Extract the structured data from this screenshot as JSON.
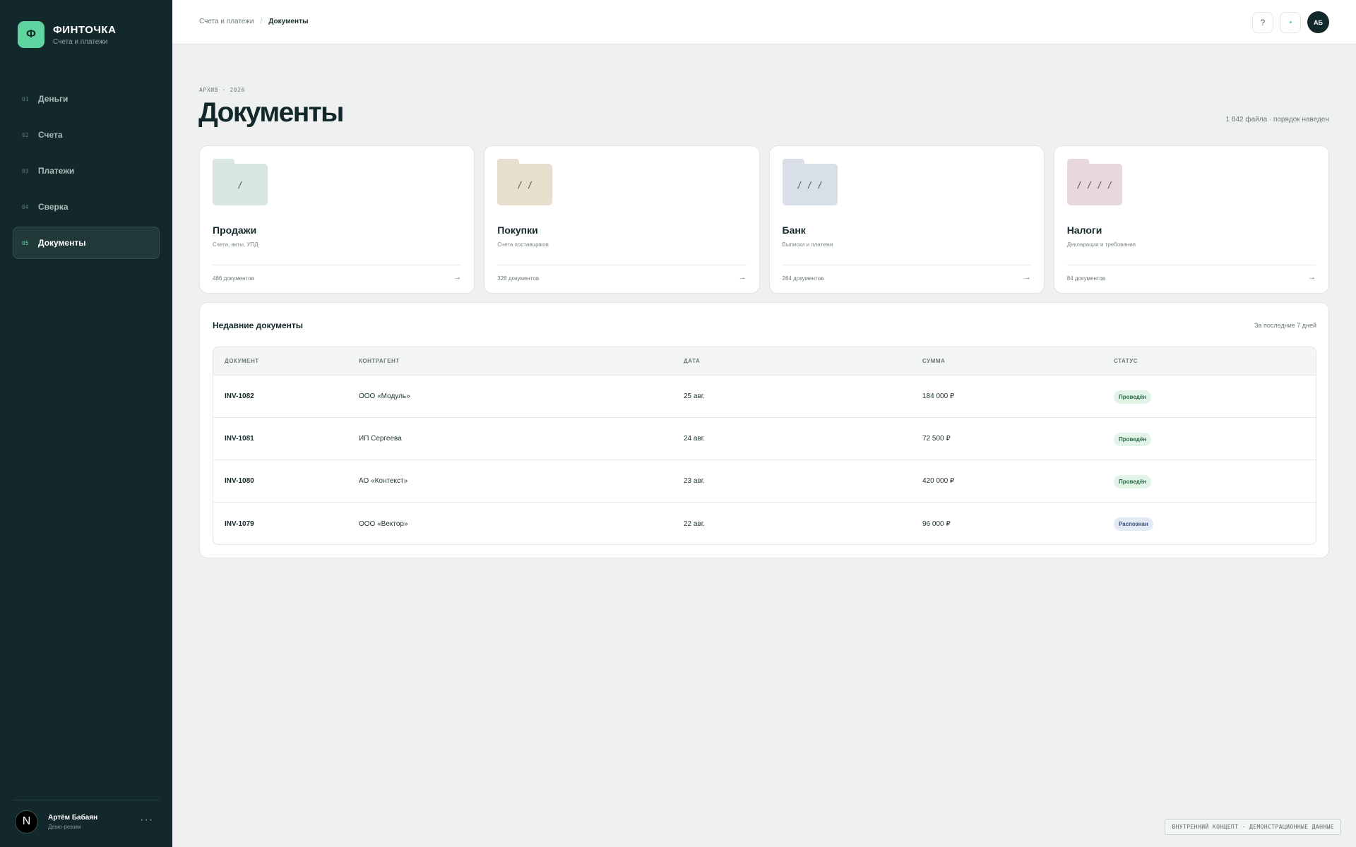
{
  "brand": {
    "logo_letter": "Ф",
    "name": "ФИНТОЧКА",
    "subtitle": "Счета и платежи"
  },
  "nav": [
    {
      "num": "01",
      "label": "Деньги",
      "active": false
    },
    {
      "num": "02",
      "label": "Счета",
      "active": false
    },
    {
      "num": "03",
      "label": "Платежи",
      "active": false
    },
    {
      "num": "04",
      "label": "Сверка",
      "active": false
    },
    {
      "num": "05",
      "label": "Документы",
      "active": true
    }
  ],
  "user": {
    "avatar_letter": "N",
    "name": "Артём Бабаян",
    "role": "Демо-режим",
    "menu_icon": "ellipsis-icon",
    "menu_glyph": "···"
  },
  "breadcrumb": {
    "parent": "Счета и платежи",
    "separator": "/",
    "current": "Документы"
  },
  "top_actions": {
    "help_glyph": "?",
    "help_icon": "question-icon",
    "status_icon": "dot-icon",
    "avatar_initials": "АБ"
  },
  "page": {
    "eyebrow": "АРХИВ · 2026",
    "title": "Документы",
    "meta": "1 842 файла · порядок наведен"
  },
  "folders": [
    {
      "title": "Продажи",
      "desc": "Счета, акты, УПД",
      "count": "486 документов",
      "mark": "/",
      "color": "#d7e6df",
      "tab_color": "#d7e6df",
      "arrow": "→"
    },
    {
      "title": "Покупки",
      "desc": "Счета поставщиков",
      "count": "328 документов",
      "mark": "/ /",
      "color": "#e6dfcd",
      "tab_color": "#e6dfcd",
      "arrow": "→"
    },
    {
      "title": "Банк",
      "desc": "Выписки и платежи",
      "count": "264 документов",
      "mark": "/ / /",
      "color": "#d8dfe8",
      "tab_color": "#d8dfe8",
      "arrow": "→"
    },
    {
      "title": "Налоги",
      "desc": "Декларации и требования",
      "count": "84 документов",
      "mark": "/ / / /",
      "color": "#e8d8dd",
      "tab_color": "#e8d8dd",
      "arrow": "→"
    }
  ],
  "recent": {
    "title": "Недавние документы",
    "range": "За последние 7 дней",
    "columns": [
      "ДОКУМЕНТ",
      "КОНТРАГЕНТ",
      "ДАТА",
      "СУММА",
      "СТАТУС"
    ],
    "rows": [
      {
        "doc": "INV-1082",
        "party": "ООО «Модуль»",
        "date": "25 авг.",
        "sum": "184 000 ₽",
        "status": "Проведён",
        "status_kind": "done"
      },
      {
        "doc": "INV-1081",
        "party": "ИП Сергеева",
        "date": "24 авг.",
        "sum": "72 500 ₽",
        "status": "Проведён",
        "status_kind": "done"
      },
      {
        "doc": "INV-1080",
        "party": "АО «Контекст»",
        "date": "23 авг.",
        "sum": "420 000 ₽",
        "status": "Проведён",
        "status_kind": "done"
      },
      {
        "doc": "INV-1079",
        "party": "ООО «Вектор»",
        "date": "22 авг.",
        "sum": "96 000 ₽",
        "status": "Распознан",
        "status_kind": "recognized"
      }
    ]
  },
  "status_colors": {
    "done": {
      "bg": "#e2f3e8",
      "fg": "#2b6b45"
    },
    "recognized": {
      "bg": "#e3eaf5",
      "fg": "#34507a"
    }
  },
  "footer_tag": "ВНУТРЕННИЙ КОНЦЕПТ · ДЕМОНСТРАЦИОННЫЕ ДАННЫЕ"
}
